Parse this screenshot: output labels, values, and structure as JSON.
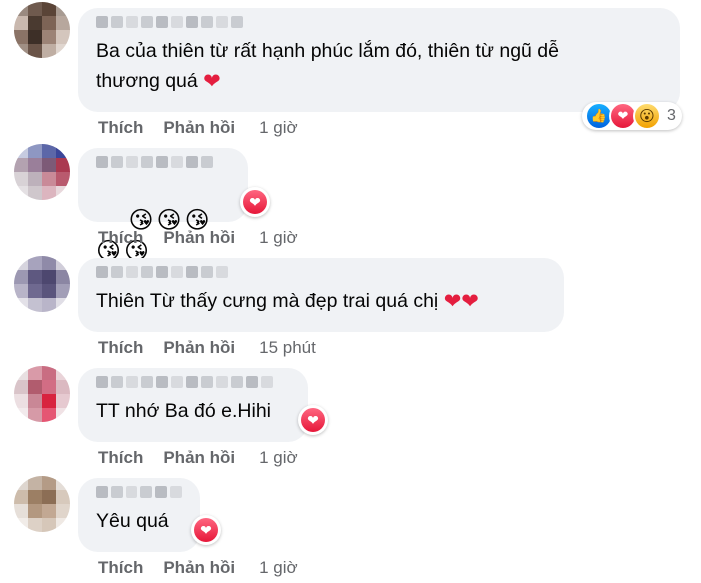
{
  "comments": [
    {
      "text": "Ba của thiên từ rất hạnh phúc lắm đó, thiên từ ngũ dễ\nthương quá",
      "reactions_count": "3",
      "actions": {
        "like": "Thích",
        "reply": "Phản hồi",
        "time": "1 giờ"
      }
    },
    {
      "emojis": [
        "😘",
        "😘",
        "😘",
        "😘",
        "😘"
      ],
      "actions": {
        "like": "Thích",
        "reply": "Phản hồi",
        "time": "1 giờ"
      }
    },
    {
      "text": "Thiên Từ thấy cưng mà đẹp trai quá chị",
      "actions": {
        "like": "Thích",
        "reply": "Phản hồi",
        "time": "15 phút"
      }
    },
    {
      "text": "TT nhớ Ba đó e.Hihi",
      "actions": {
        "like": "Thích",
        "reply": "Phản hồi",
        "time": "1 giờ"
      }
    },
    {
      "text": "Yêu quá",
      "actions": {
        "like": "Thích",
        "reply": "Phản hồi",
        "time": "1 giờ"
      }
    }
  ],
  "colors": {
    "bubble_bg": "#f0f2f5",
    "secondary_text": "#65676b",
    "heart": "#e41e3f"
  },
  "icons": {
    "heart": "heart-icon",
    "like_reaction": "like-reaction-icon",
    "love_reaction": "love-reaction-icon",
    "wow_reaction": "wow-reaction-icon",
    "kiss_emoji": "kissing-face-emoji"
  }
}
